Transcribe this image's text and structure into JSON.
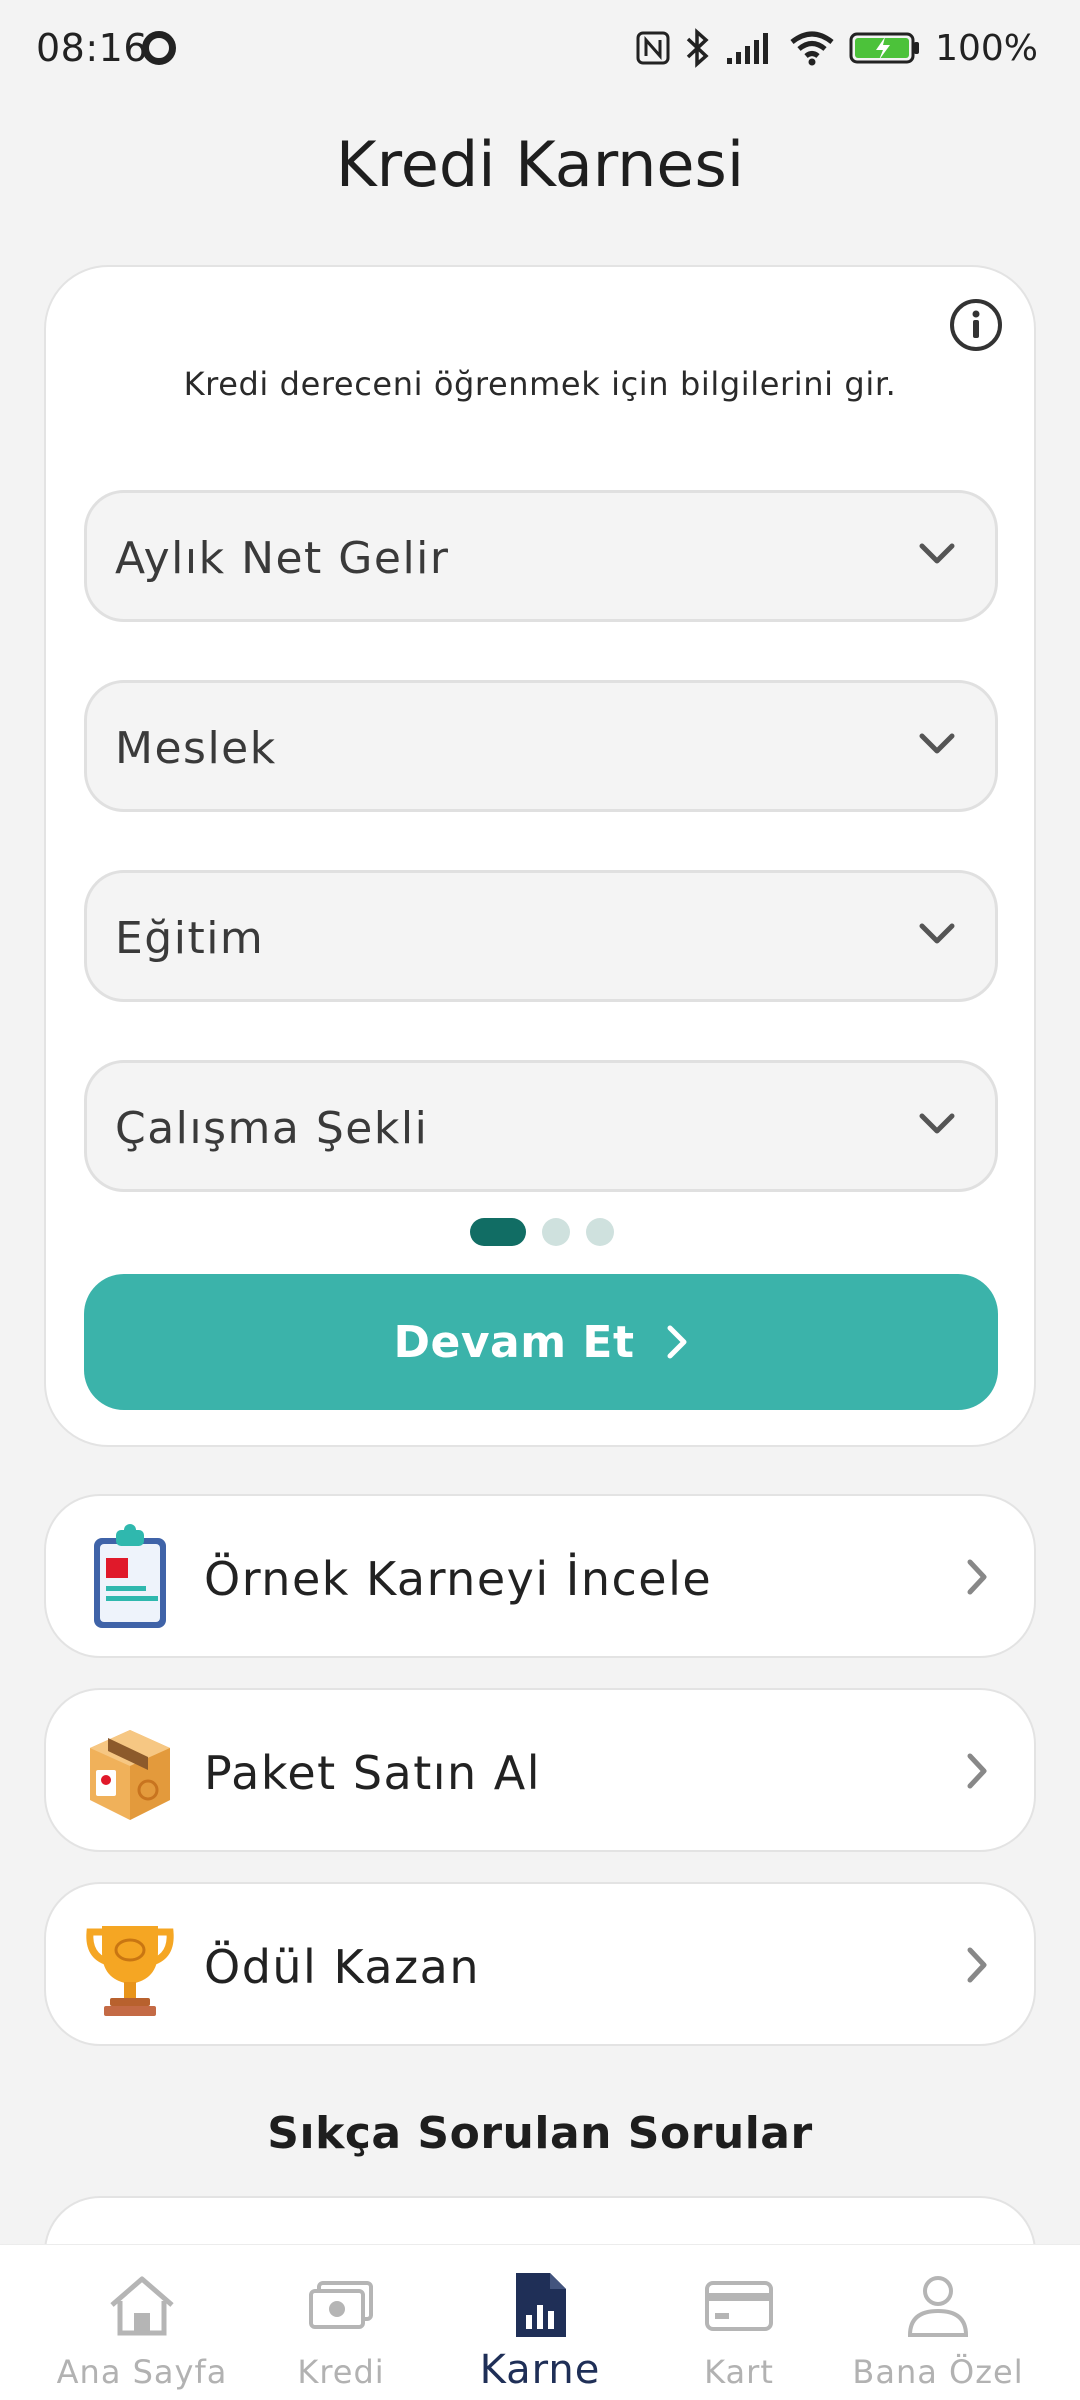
{
  "status_bar": {
    "time": "08:16",
    "battery_text": "100%"
  },
  "header": {
    "title": "Kredi Karnesi"
  },
  "card": {
    "subtitle": "Kredi dereceni öğrenmek için bilgilerini gir.",
    "fields": [
      {
        "label": "Aylık Net Gelir"
      },
      {
        "label": "Meslek"
      },
      {
        "label": "Eğitim"
      },
      {
        "label": "Çalışma Şekli"
      }
    ],
    "pager": {
      "current": 1,
      "total": 3
    },
    "continue_label": "Devam Et"
  },
  "actions": [
    {
      "label": "Örnek Karneyi İncele",
      "icon": "clipboard-icon"
    },
    {
      "label": "Paket Satın Al",
      "icon": "package-box-icon"
    },
    {
      "label": "Ödül Kazan",
      "icon": "trophy-icon"
    }
  ],
  "faq": {
    "title": "Sıkça Sorulan Sorular"
  },
  "bottom_nav": [
    {
      "label": "Ana Sayfa",
      "icon": "home-icon",
      "active": false
    },
    {
      "label": "Kredi",
      "icon": "money-icon",
      "active": false
    },
    {
      "label": "Karne",
      "icon": "report-icon",
      "active": true
    },
    {
      "label": "Kart",
      "icon": "card-icon",
      "active": false
    },
    {
      "label": "Bana Özel",
      "icon": "user-icon",
      "active": false
    }
  ],
  "colors": {
    "accent": "#3bb3aa",
    "pager_active": "#116d64",
    "nav_active": "#1f2f57"
  }
}
